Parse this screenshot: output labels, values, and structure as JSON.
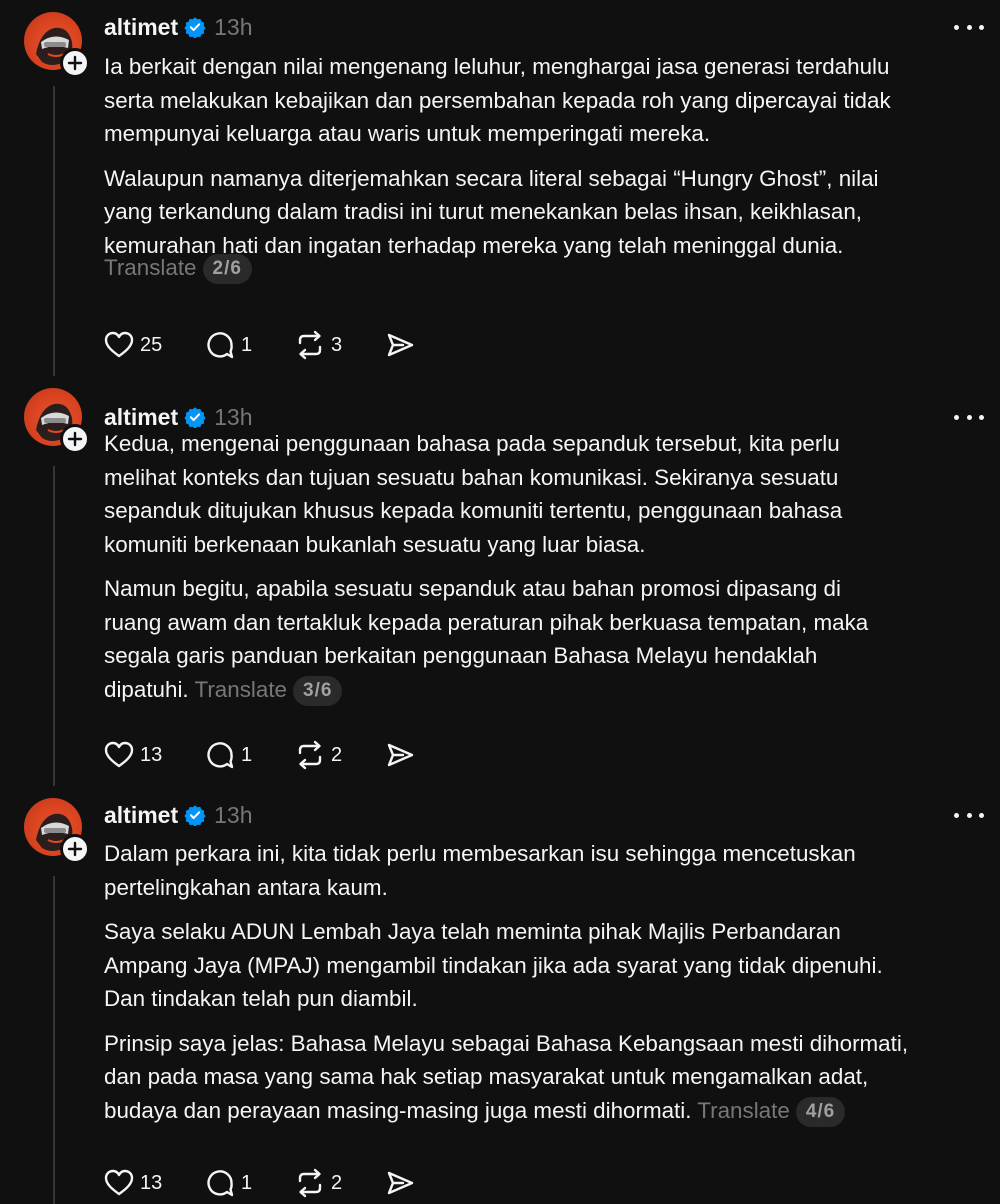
{
  "posts": [
    {
      "username": "altimet",
      "time": "13h",
      "paragraphs": [
        [
          "Ia berkait dengan nilai mengenang leluhur, menghargai jasa generasi terdahulu",
          "serta melakukan kebajikan dan persembahan kepada roh yang dipercayai tidak",
          "mempunyai keluarga atau waris untuk memperingati mereka."
        ],
        [
          "Walaupun namanya diterjemahkan secara literal sebagai “Hungry Ghost”, nilai",
          "yang terkandung dalam tradisi ini turut menekankan belas ihsan, keikhlasan,",
          "kemurahan hati dan ingatan terhadap mereka yang telah meninggal dunia."
        ]
      ],
      "translate_label": "Translate",
      "page": "2/6",
      "likes": "25",
      "replies": "1",
      "reposts": "3"
    },
    {
      "username": "altimet",
      "time": "13h",
      "paragraphs": [
        [
          "Kedua, mengenai penggunaan bahasa pada sepanduk tersebut, kita perlu",
          "melihat konteks dan tujuan sesuatu bahan komunikasi. Sekiranya sesuatu",
          "sepanduk ditujukan khusus kepada komuniti tertentu, penggunaan bahasa",
          "komuniti berkenaan bukanlah sesuatu yang luar biasa."
        ],
        [
          "Namun begitu, apabila sesuatu sepanduk atau bahan promosi dipasang di",
          "ruang awam dan tertakluk kepada peraturan pihak berkuasa tempatan, maka",
          "segala garis panduan berkaitan penggunaan Bahasa Melayu hendaklah",
          "dipatuhi."
        ]
      ],
      "translate_label": "Translate",
      "page": "3/6",
      "likes": "13",
      "replies": "1",
      "reposts": "2"
    },
    {
      "username": "altimet",
      "time": "13h",
      "paragraphs": [
        [
          "Dalam perkara ini, kita tidak perlu membesarkan isu sehingga mencetuskan",
          "pertelingkahan antara kaum."
        ],
        [
          "Saya selaku ADUN Lembah Jaya telah meminta pihak Majlis Perbandaran",
          "Ampang Jaya (MPAJ) mengambil tindakan jika ada syarat yang tidak dipenuhi.",
          "Dan tindakan telah pun diambil."
        ],
        [
          "Prinsip saya jelas: Bahasa Melayu sebagai Bahasa Kebangsaan mesti dihormati,",
          "dan pada masa yang sama hak setiap masyarakat untuk mengamalkan adat,",
          "budaya dan perayaan masing-masing juga mesti dihormati."
        ]
      ],
      "translate_label": "Translate",
      "page": "4/6",
      "likes": "13",
      "replies": "1",
      "reposts": "2"
    }
  ],
  "colors": {
    "background": "#101010",
    "text": "#f3f5f7",
    "muted": "#777777",
    "verified": "#0095f6",
    "avatar": "#e04a26"
  },
  "icons": {
    "verified": "verified-badge-icon",
    "follow": "plus-icon",
    "more": "more-icon",
    "like": "heart-icon",
    "reply": "comment-icon",
    "repost": "repost-icon",
    "share": "send-icon"
  }
}
